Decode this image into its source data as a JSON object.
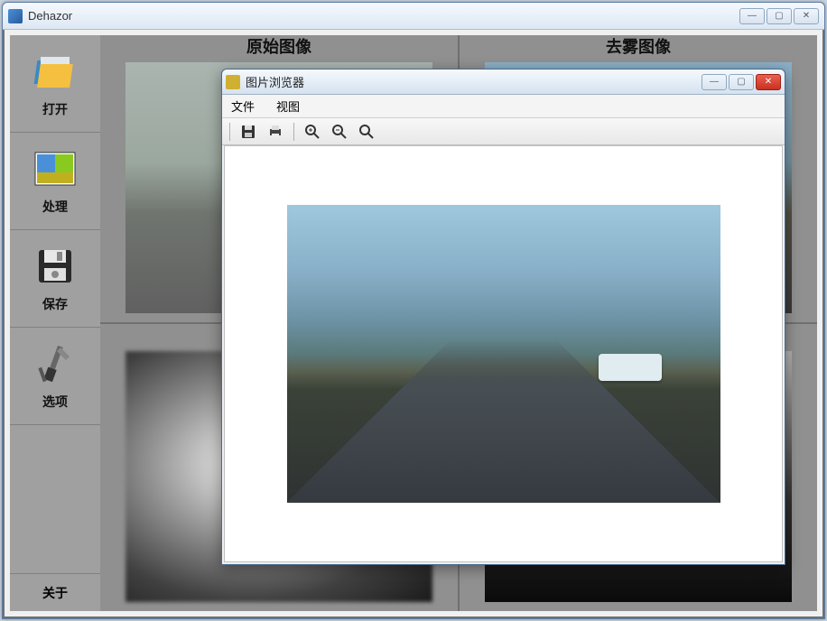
{
  "main_window": {
    "title": "Dehazor",
    "controls": {
      "min": "—",
      "max": "▢",
      "close": "✕"
    }
  },
  "sidebar": {
    "open": "打开",
    "process": "处理",
    "save": "保存",
    "options": "选项",
    "about": "关于"
  },
  "panels": {
    "original": "原始图像",
    "dehazed": "去雾图像"
  },
  "dialog": {
    "title": "图片浏览器",
    "menu_file": "文件",
    "menu_view": "视图",
    "controls": {
      "min": "—",
      "max": "▢",
      "close": "✕"
    }
  }
}
